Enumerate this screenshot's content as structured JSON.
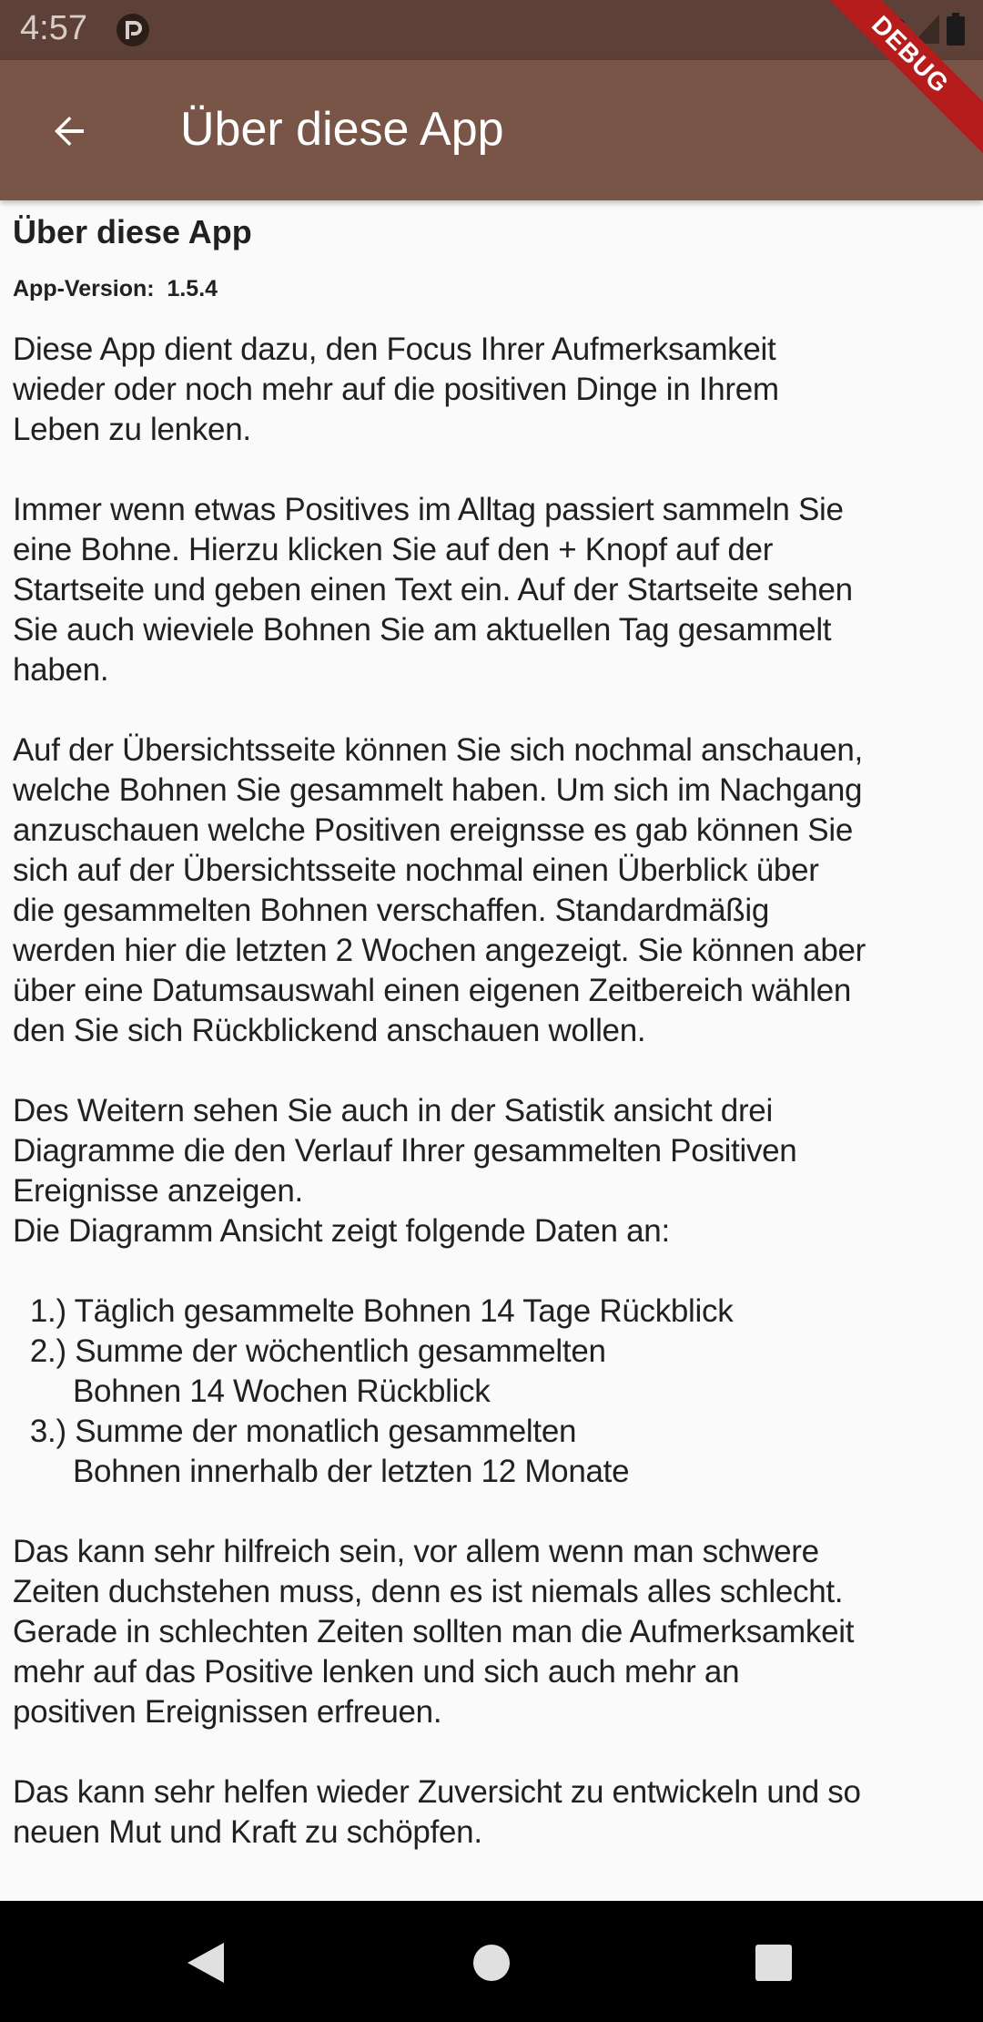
{
  "statusbar": {
    "time": "4:57",
    "debug_label": "DEBUG"
  },
  "appbar": {
    "title": "Über diese App"
  },
  "content": {
    "title": "Über diese App",
    "version": "App-Version:  1.5.4",
    "body": "Diese App dient dazu, den Focus Ihrer Aufmerksamkeit\nwieder oder noch mehr auf die positiven Dinge in Ihrem\nLeben zu lenken.\n\nImmer wenn etwas Positives im Alltag passiert sammeln Sie\neine Bohne. Hierzu klicken Sie auf den + Knopf auf der\nStartseite und geben einen Text ein. Auf der Startseite sehen\nSie auch wieviele Bohnen Sie am aktuellen Tag gesammelt\nhaben.\n\nAuf der Übersichtsseite können Sie sich nochmal anschauen,\nwelche Bohnen Sie gesammelt haben. Um sich im Nachgang\nanzuschauen welche Positiven ereignsse es gab können Sie\nsich auf der Übersichtsseite nochmal einen Überblick über\ndie gesammelten Bohnen verschaffen. Standardmäßig\nwerden hier die letzten 2 Wochen angezeigt. Sie können aber\nüber eine Datumsauswahl einen eigenen Zeitbereich wählen\nden Sie sich Rückblickend anschauen wollen.\n\nDes Weitern sehen Sie auch in der Satistik ansicht drei\nDiagramme die den Verlauf Ihrer gesammelten Positiven\nEreignisse anzeigen.\nDie Diagramm Ansicht zeigt folgende Daten an:\n\n  1.) Täglich gesammelte Bohnen 14 Tage Rückblick\n  2.) Summe der wöchentlich gesammelten\n       Bohnen 14 Wochen Rückblick\n  3.) Summe der monatlich gesammelten\n       Bohnen innerhalb der letzten 12 Monate\n\nDas kann sehr hilfreich sein, vor allem wenn man schwere\nZeiten duchstehen muss, denn es ist niemals alles schlecht.\nGerade in schlechten Zeiten sollten man die Aufmerksamkeit\nmehr auf das Positive lenken und sich auch mehr an\npositiven Ereignissen erfreuen.\n\nDas kann sehr helfen wieder Zuversicht zu entwickeln und so\nneuen Mut und Kraft zu schöpfen."
  },
  "colors": {
    "statusbar": "#5d4037",
    "appbar": "#795548",
    "background": "#fafafa",
    "text": "#212121",
    "navbar": "#000000"
  },
  "icons": {
    "back": "arrow-left-icon",
    "notification": "app-notification-icon",
    "wifi": "wifi-icon",
    "signal": "signal-icon",
    "battery": "battery-icon",
    "nav_back": "triangle-back-icon",
    "nav_home": "circle-home-icon",
    "nav_recents": "square-recents-icon"
  }
}
